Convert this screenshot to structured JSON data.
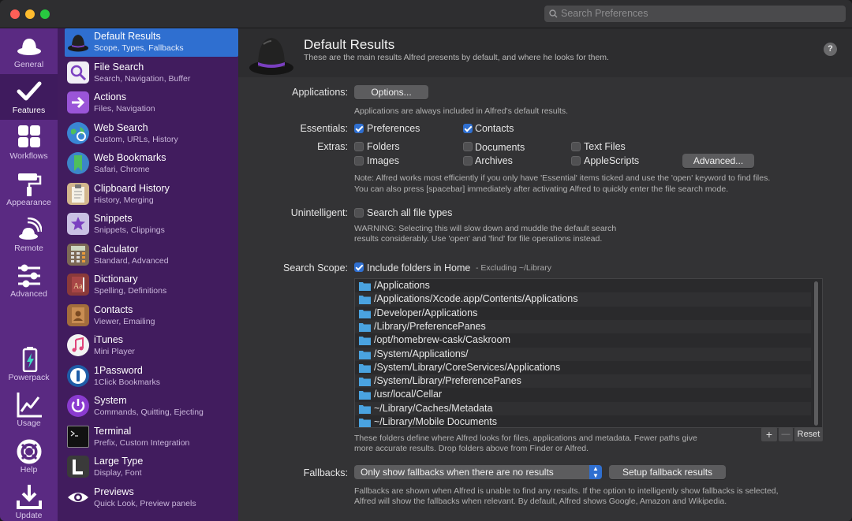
{
  "search": {
    "placeholder": "Search Preferences"
  },
  "rail": [
    {
      "label": "General",
      "icon": "hat-icon"
    },
    {
      "label": "Features",
      "icon": "checkmark-icon"
    },
    {
      "label": "Workflows",
      "icon": "grid-icon"
    },
    {
      "label": "Appearance",
      "icon": "paint-roller-icon"
    },
    {
      "label": "Remote",
      "icon": "remote-icon"
    },
    {
      "label": "Advanced",
      "icon": "sliders-icon"
    },
    {
      "label": "Powerpack",
      "icon": "battery-icon"
    },
    {
      "label": "Usage",
      "icon": "chart-icon"
    },
    {
      "label": "Help",
      "icon": "lifebuoy-icon"
    },
    {
      "label": "Update",
      "icon": "download-icon"
    }
  ],
  "features": [
    {
      "title": "Default Results",
      "sub": "Scope, Types, Fallbacks",
      "color": "#2a2a2a"
    },
    {
      "title": "File Search",
      "sub": "Search, Navigation, Buffer",
      "color": "#f0eef5"
    },
    {
      "title": "Actions",
      "sub": "Files, Navigation",
      "color": "#9a55d8"
    },
    {
      "title": "Web Search",
      "sub": "Custom, URLs, History",
      "color": "#3a86d4"
    },
    {
      "title": "Web Bookmarks",
      "sub": "Safari, Chrome",
      "color": "#3c86c9"
    },
    {
      "title": "Clipboard History",
      "sub": "History, Merging",
      "color": "#d2b68d"
    },
    {
      "title": "Snippets",
      "sub": "Snippets, Clippings",
      "color": "#c9c0e3"
    },
    {
      "title": "Calculator",
      "sub": "Standard, Advanced",
      "color": "#7d6a56"
    },
    {
      "title": "Dictionary",
      "sub": "Spelling, Definitions",
      "color": "#8a3a3a"
    },
    {
      "title": "Contacts",
      "sub": "Viewer, Emailing",
      "color": "#a36d3c"
    },
    {
      "title": "iTunes",
      "sub": "Mini Player",
      "color": "#f3f3f3"
    },
    {
      "title": "1Password",
      "sub": "1Click Bookmarks",
      "color": "#1f5da8"
    },
    {
      "title": "System",
      "sub": "Commands, Quitting, Ejecting",
      "color": "#8a3bcf"
    },
    {
      "title": "Terminal",
      "sub": "Prefix, Custom Integration",
      "color": "#111111"
    },
    {
      "title": "Large Type",
      "sub": "Display, Font",
      "color": "#3a3a3a"
    },
    {
      "title": "Previews",
      "sub": "Quick Look, Preview panels",
      "color": "#4a4a4a"
    }
  ],
  "header": {
    "title": "Default Results",
    "subtitle": "These are the main results Alfred presents by default, and where he looks for them."
  },
  "applications": {
    "label": "Applications:",
    "button": "Options...",
    "note": "Applications are always included in Alfred's default results."
  },
  "essentials": {
    "label": "Essentials:",
    "items": [
      {
        "label": "Preferences",
        "checked": true
      },
      {
        "label": "Contacts",
        "checked": true
      }
    ]
  },
  "extras": {
    "label": "Extras:",
    "items": [
      {
        "label": "Folders",
        "checked": false
      },
      {
        "label": "Documents",
        "checked": false
      },
      {
        "label": "Text Files",
        "checked": false
      },
      {
        "label": "Images",
        "checked": false
      },
      {
        "label": "Archives",
        "checked": false
      },
      {
        "label": "AppleScripts",
        "checked": false
      }
    ],
    "advanced_button": "Advanced...",
    "note1": "Note: Alfred works most efficiently if you only have 'Essential' items ticked and use the 'open' keyword to find files.",
    "note2": "You can also press [spacebar] immediately after activating Alfred to quickly enter the file search mode."
  },
  "unintelligent": {
    "label": "Unintelligent:",
    "checkbox": "Search all file types",
    "checked": false,
    "warning1": "WARNING: Selecting this will slow down and muddle the default search",
    "warning2": "results considerably. Use 'open' and 'find' for file operations instead."
  },
  "scope": {
    "label": "Search Scope:",
    "checkbox": "Include folders in Home",
    "checked": true,
    "excluding": "- Excluding ~/Library",
    "paths": [
      "/Applications",
      "/Applications/Xcode.app/Contents/Applications",
      "/Developer/Applications",
      "/Library/PreferencePanes",
      "/opt/homebrew-cask/Caskroom",
      "/System/Applications/",
      "/System/Library/CoreServices/Applications",
      "/System/Library/PreferencePanes",
      "/usr/local/Cellar",
      "~/Library/Caches/Metadata",
      "~/Library/Mobile Documents"
    ],
    "add": "+",
    "remove": "—",
    "reset": "Reset",
    "note1": "These folders define where Alfred looks for files, applications and metadata. Fewer paths give",
    "note2": "more accurate results. Drop folders above from Finder or Alfred."
  },
  "fallbacks": {
    "label": "Fallbacks:",
    "selected": "Only show fallbacks when there are no results",
    "setup_button": "Setup fallback results",
    "note1": "Fallbacks are shown when Alfred is unable to find any results. If the option to intelligently show fallbacks is selected,",
    "note2": "Alfred will show the fallbacks when relevant. By default, Alfred shows Google, Amazon and Wikipedia."
  },
  "help": "?",
  "colors": {
    "accent": "#2f6fd0",
    "rail": "#5a2a82",
    "list": "#411c5e"
  }
}
